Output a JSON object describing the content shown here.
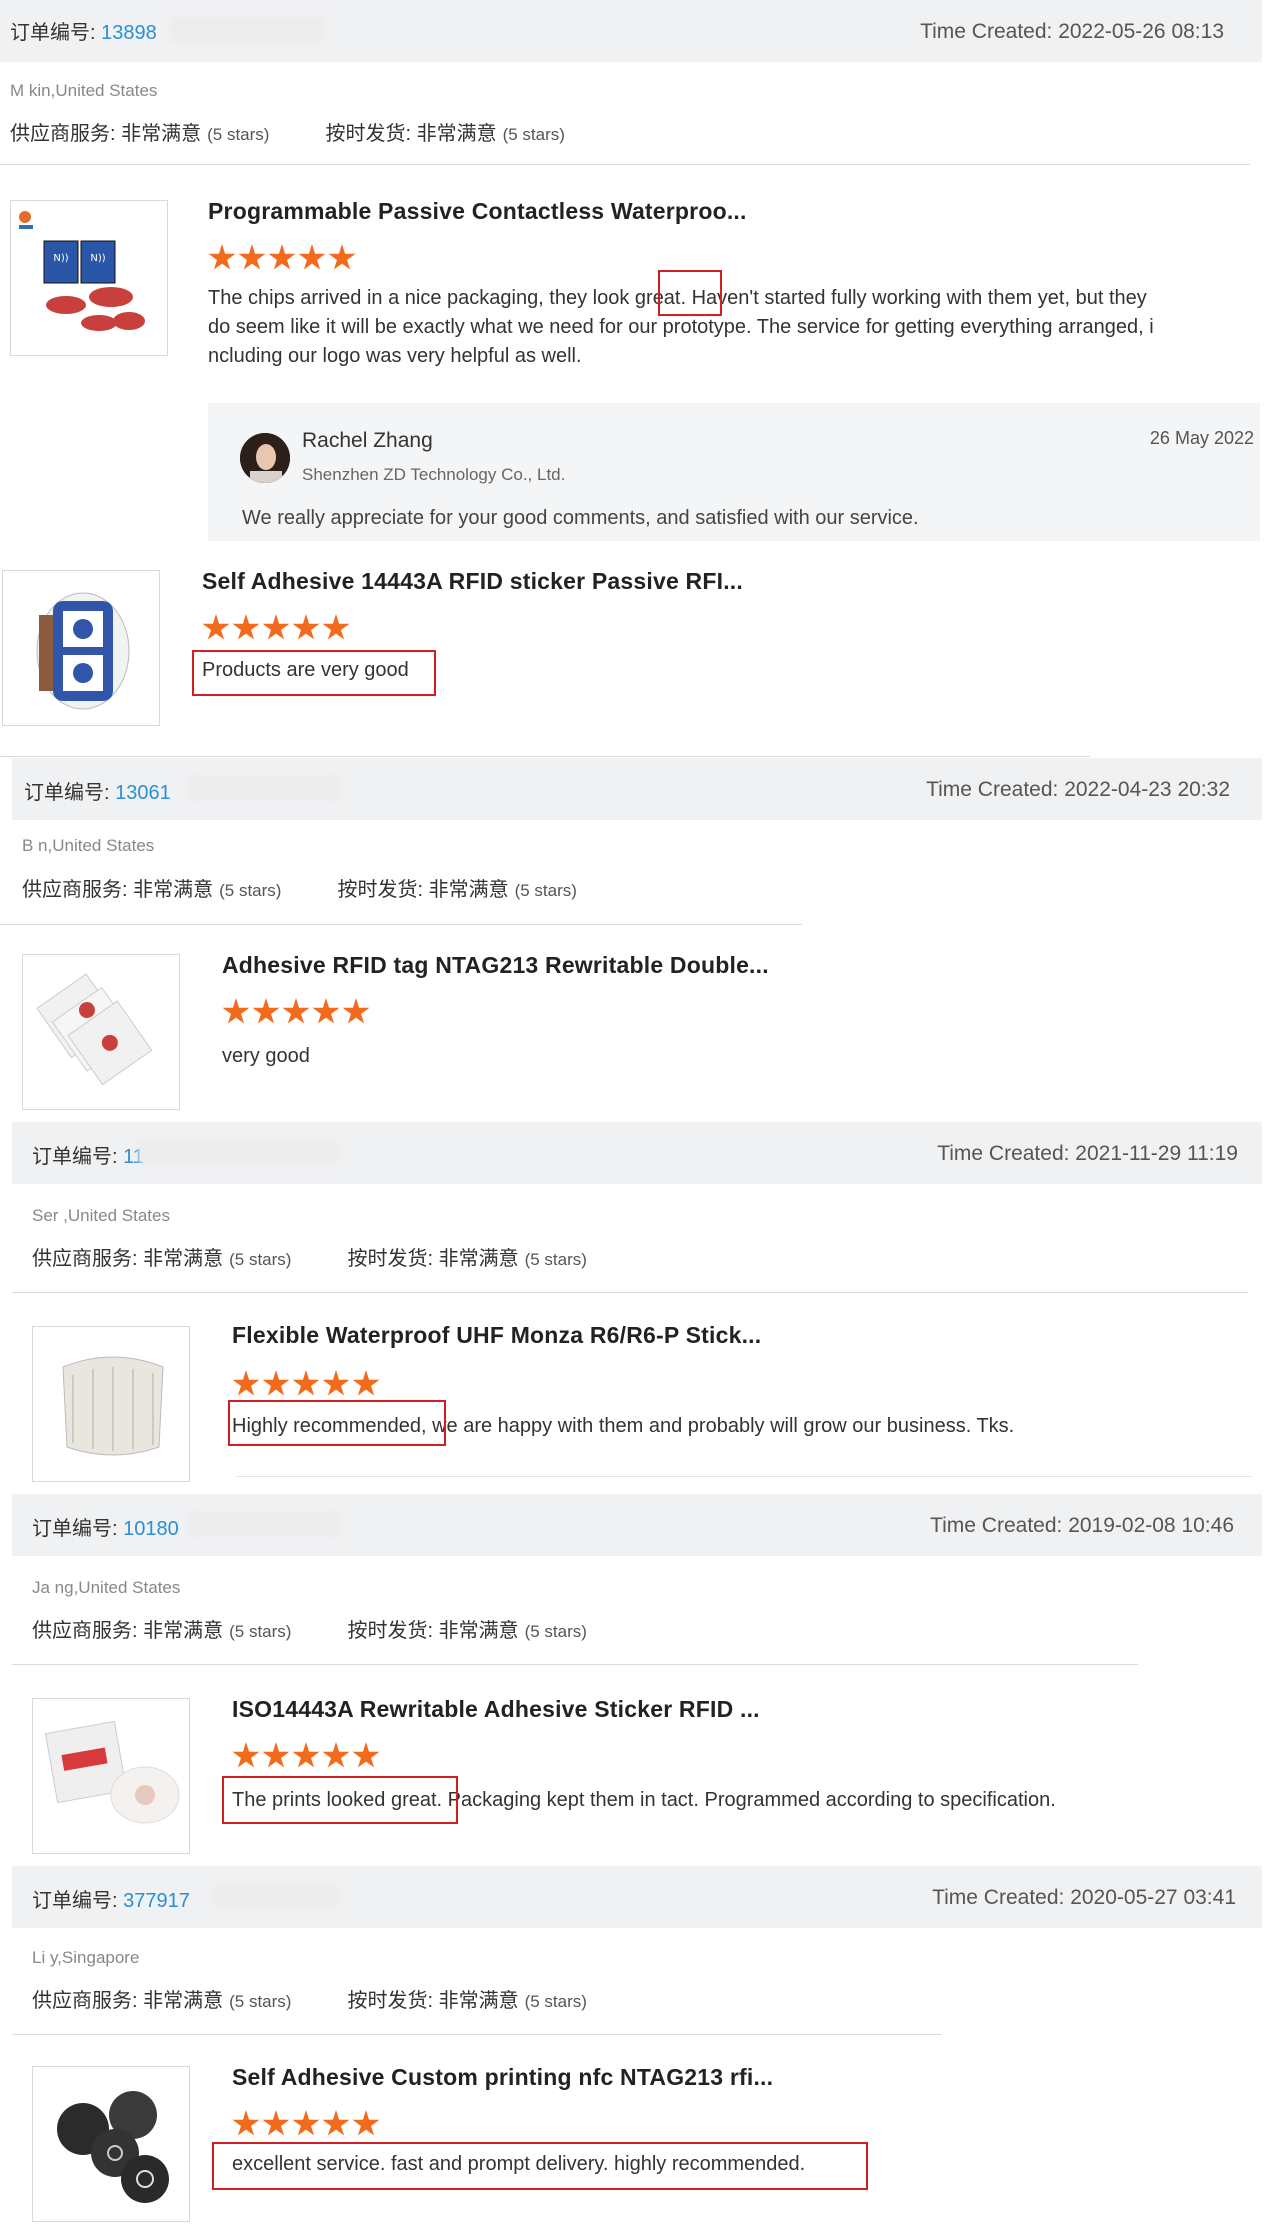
{
  "labels": {
    "order_prefix": "订单编号: ",
    "time_prefix": "Time Created: ",
    "supplier_service": "供应商服务: ",
    "on_time": "按时发货: ",
    "very_satisfied": "非常满意",
    "five_stars": "(5 stars)"
  },
  "orders": [
    {
      "order_no": "13898",
      "time_created": "2022-05-26 08:13",
      "location": "M          kin,United States",
      "reviews": [
        {
          "product_title": "Programmable Passive Contactless Waterproo...",
          "rating": 5,
          "text_lines": [
            "The chips arrived in a nice packaging, they look great.  Haven't started fully working with them yet, but they",
            "do seem like it will be exactly what we need for our prototype.  The service for getting everything arranged, i",
            "ncluding our logo was very helpful as well."
          ],
          "reply": {
            "name": "Rachel Zhang",
            "company": "Shenzhen ZD Technology Co., Ltd.",
            "date": "26 May 2022",
            "text": "We really appreciate for your good comments, and satisfied with our service."
          }
        },
        {
          "product_title": "Self Adhesive 14443A RFID sticker Passive RFI...",
          "rating": 5,
          "text_lines": [
            "Products are very good"
          ]
        }
      ]
    },
    {
      "order_no": "13061",
      "time_created": "2022-04-23 20:32",
      "location": "B           n,United States",
      "reviews": [
        {
          "product_title": "Adhesive RFID tag NTAG213 Rewritable Double...",
          "rating": 5,
          "text_lines": [
            "very good"
          ]
        }
      ]
    },
    {
      "order_no": "11",
      "time_created": "2021-11-29 11:19",
      "location": "Ser             ,United States",
      "reviews": [
        {
          "product_title": "Flexible Waterproof UHF Monza R6/R6-P Stick...",
          "rating": 5,
          "text_lines": [
            "Highly recommended, we are happy with them and probably will grow our business. Tks."
          ]
        }
      ]
    },
    {
      "order_no": "10180",
      "time_created": "2019-02-08 10:46",
      "location": "Ja          ng,United States",
      "reviews": [
        {
          "product_title": "ISO14443A Rewritable Adhesive Sticker RFID ...",
          "rating": 5,
          "text_lines": [
            "The prints looked great.  Packaging kept them in tact.  Programmed according to specification."
          ]
        }
      ]
    },
    {
      "order_no": "377917",
      "time_created": "2020-05-27 03:41",
      "location": "Li         y,Singapore",
      "reviews": [
        {
          "product_title": "Self Adhesive Custom printing nfc NTAG213 rfi...",
          "rating": 5,
          "text_lines": [
            "excellent service. fast and prompt delivery. highly recommended."
          ]
        }
      ]
    }
  ]
}
